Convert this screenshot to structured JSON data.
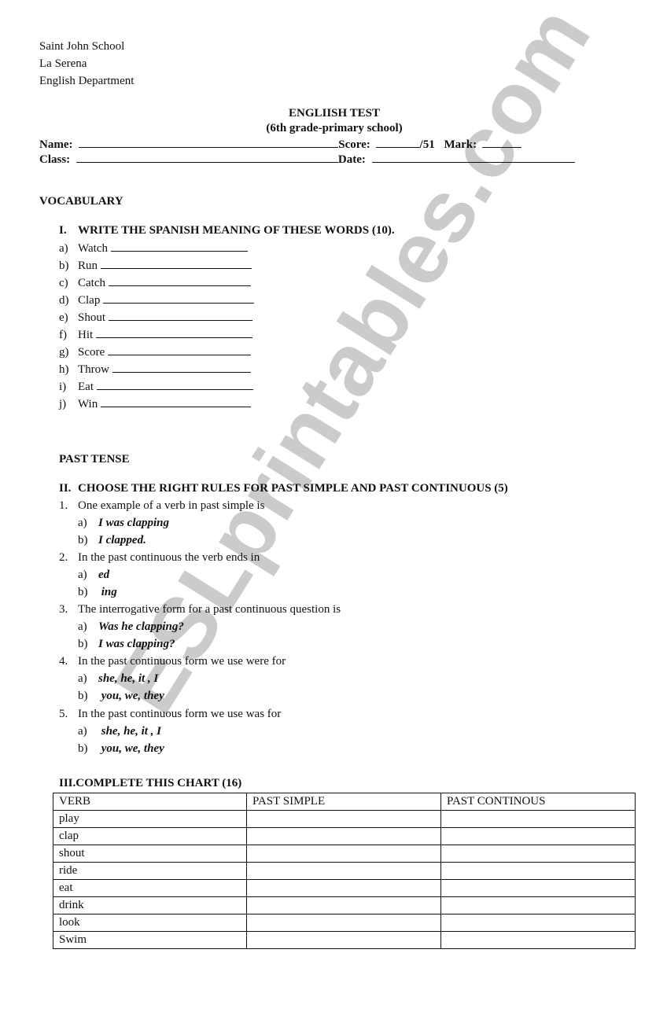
{
  "header": {
    "school": "Saint John School",
    "city": "La Serena",
    "department": "English Department"
  },
  "title": {
    "main": "ENGLIISH TEST",
    "sub": "(6th grade-primary school)"
  },
  "fields": {
    "name_label": "Name:",
    "score_label": "Score:",
    "score_total": "/51",
    "mark_label": "Mark:",
    "class_label": "Class:",
    "date_label": "Date:"
  },
  "vocabulary": {
    "heading": "VOCABULARY",
    "instruction_num": "I.",
    "instruction": "WRITE THE SPANISH MEANING OF THESE WORDS (10).",
    "items": [
      {
        "letter": "a)",
        "word": "Watch"
      },
      {
        "letter": "b)",
        "word": "Run"
      },
      {
        "letter": "c)",
        "word": "Catch"
      },
      {
        "letter": "d)",
        "word": "Clap"
      },
      {
        "letter": "e)",
        "word": "Shout"
      },
      {
        "letter": "f)",
        "word": "Hit"
      },
      {
        "letter": "g)",
        "word": "Score"
      },
      {
        "letter": "h)",
        "word": "Throw"
      },
      {
        "letter": "i)",
        "word": "Eat"
      },
      {
        "letter": "j)",
        "word": "Win"
      }
    ]
  },
  "past_tense": {
    "heading": "PAST TENSE",
    "instruction_num": "II.",
    "instruction": "CHOOSE THE RIGHT  RULES FOR PAST SIMPLE AND PAST CONTINUOUS (5)",
    "questions": [
      {
        "num": "1.",
        "text": "One example of a verb in past simple is",
        "options": [
          {
            "letter": "a)",
            "text": "I was clapping"
          },
          {
            "letter": "b)",
            "text": "I clapped."
          }
        ]
      },
      {
        "num": "2.",
        "text": "In the past continuous the verb ends in",
        "options": [
          {
            "letter": "a)",
            "text": "ed"
          },
          {
            "letter": "b)",
            "text": " ing"
          }
        ]
      },
      {
        "num": "3.",
        "text": "The interrogative form for a past continuous question is",
        "options": [
          {
            "letter": "a)",
            "text": "Was he clapping?"
          },
          {
            "letter": "b)",
            "text": "I was clapping?"
          }
        ]
      },
      {
        "num": "4.",
        "text": "In the past continuous form we use were for",
        "options": [
          {
            "letter": "a)",
            "text": "she, he, it , I"
          },
          {
            "letter": "b)",
            "text": " you, we, they"
          }
        ]
      },
      {
        "num": "5.",
        "text": "In the past continuous form we use was for",
        "options": [
          {
            "letter": "a)",
            "text": " she, he, it , I"
          },
          {
            "letter": "b)",
            "text": " you, we, they"
          }
        ]
      }
    ]
  },
  "chart": {
    "heading": "III.COMPLETE THIS CHART (16)",
    "columns": [
      "VERB",
      "PAST SIMPLE",
      "PAST CONTINOUS"
    ],
    "rows": [
      "play",
      "clap",
      "shout",
      "ride",
      "eat",
      "drink",
      "look",
      "Swim"
    ]
  },
  "watermark": {
    "text": "ESLprintables.com",
    "color": "#c9c9c9"
  }
}
